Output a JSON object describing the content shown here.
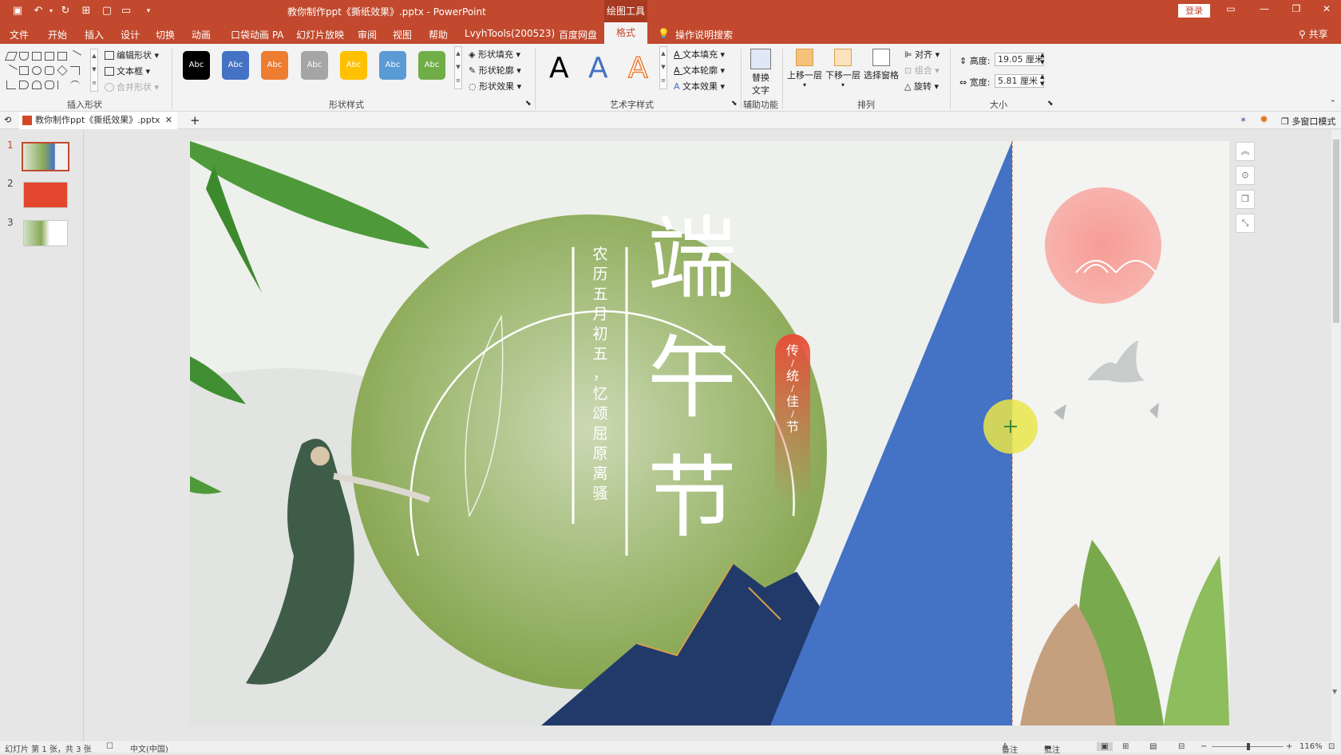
{
  "titlebar": {
    "title": "教你制作ppt《撕纸效果》.pptx  -  PowerPoint",
    "context_tab": "绘图工具",
    "login": "登录"
  },
  "menu": {
    "items": [
      "文件",
      "开始",
      "插入",
      "设计",
      "切换",
      "动画",
      "口袋动画 PA",
      "幻灯片放映",
      "审阅",
      "视图",
      "帮助",
      "LvyhTools(200523)",
      "百度网盘"
    ],
    "active": "格式",
    "search": "操作说明搜索",
    "share": "共享"
  },
  "ribbon": {
    "insert_shapes": {
      "edit_shape": "编辑形状",
      "text_box": "文本框",
      "merge_shapes": "合并形状",
      "label": "插入形状"
    },
    "shape_styles": {
      "swatches": [
        {
          "text": "Abc",
          "color": "#000000"
        },
        {
          "text": "Abc",
          "color": "#4472c4"
        },
        {
          "text": "Abc",
          "color": "#ed7d31"
        },
        {
          "text": "Abc",
          "color": "#a5a5a5"
        },
        {
          "text": "Abc",
          "color": "#ffc000"
        },
        {
          "text": "Abc",
          "color": "#5b9bd5"
        },
        {
          "text": "Abc",
          "color": "#70ad47"
        }
      ],
      "fill": "形状填充",
      "outline": "形状轮廓",
      "effects": "形状效果",
      "label": "形状样式"
    },
    "wordart": {
      "letters": [
        "A",
        "A",
        "A"
      ],
      "text_fill": "文本填充",
      "text_outline": "文本轮廓",
      "text_effects": "文本效果",
      "label": "艺术字样式"
    },
    "accessibility": {
      "alt_text_line1": "替换",
      "alt_text_line2": "文字",
      "label": "辅助功能"
    },
    "arrange": {
      "bring_forward": "上移一层",
      "send_backward": "下移一层",
      "selection_pane": "选择窗格",
      "align": "对齐",
      "group": "组合",
      "rotate": "旋转",
      "label": "排列"
    },
    "size": {
      "height_label": "高度:",
      "height_value": "19.05 厘米",
      "width_label": "宽度:",
      "width_value": "5.81 厘米",
      "label": "大小"
    }
  },
  "tabbar": {
    "doc_tab": "教你制作ppt《撕纸效果》.pptx",
    "multi_window": "多窗口模式"
  },
  "thumbnails": [
    {
      "num": "1"
    },
    {
      "num": "2"
    },
    {
      "num": "3"
    }
  ],
  "slide": {
    "title_chars": [
      "端",
      "午",
      "节"
    ],
    "subtitle_col1": [
      "农",
      "历",
      "五",
      "月",
      "初",
      "五",
      "，"
    ],
    "subtitle_col2": [
      "忆",
      "颂",
      "屈",
      "原",
      "离",
      "骚"
    ],
    "badge_chars": [
      "传",
      "统",
      "佳",
      "节"
    ],
    "colors": {
      "blue_triangle": "#4472c4",
      "green_circle": "#8aaa58",
      "badge_red": "#e0553d",
      "sun_pink": "#f6a8a2"
    }
  },
  "statusbar": {
    "slide_info": "幻灯片 第 1 张，共 3 张",
    "language": "中文(中国)",
    "notes": "备注",
    "comments": "批注",
    "zoom": "116%"
  }
}
